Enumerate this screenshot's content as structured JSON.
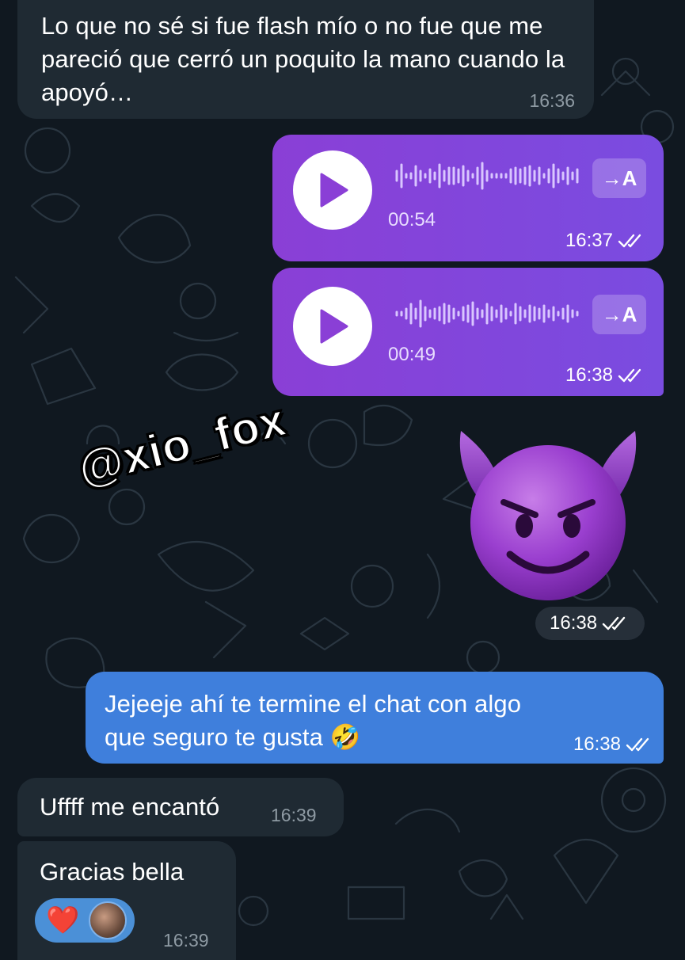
{
  "watermark": "@xio_fox",
  "messages": {
    "m1": {
      "text": "Lo que no sé si fue flash mío o no fue que me pareció que cerró un poquito la mano cuando la apoyó…",
      "time": "16:36"
    },
    "voice1": {
      "duration": "00:54",
      "time": "16:37",
      "transcribe_label": "→A"
    },
    "voice2": {
      "duration": "00:49",
      "time": "16:38",
      "transcribe_label": "→A"
    },
    "sticker": {
      "emoji": "smiling-face-with-horns",
      "time": "16:38"
    },
    "m2": {
      "text": "Jejeeje ahí te termine el chat con algo que seguro te gusta 🤣",
      "time": "16:38"
    },
    "m3": {
      "text": "Uffff me encantó",
      "time": "16:39"
    },
    "m4": {
      "text": "Gracias bella",
      "time": "16:39",
      "reaction": "❤️"
    }
  },
  "colors": {
    "background": "#101820",
    "incoming_bubble": "#1f2a33",
    "voice_bubble": "#8a3fd6",
    "outgoing_bubble": "#3f7fdc",
    "reaction_pill": "#4b90d7"
  },
  "icons": [
    "play-icon",
    "waveform-icon",
    "double-check-icon",
    "heart-icon",
    "avatar"
  ]
}
